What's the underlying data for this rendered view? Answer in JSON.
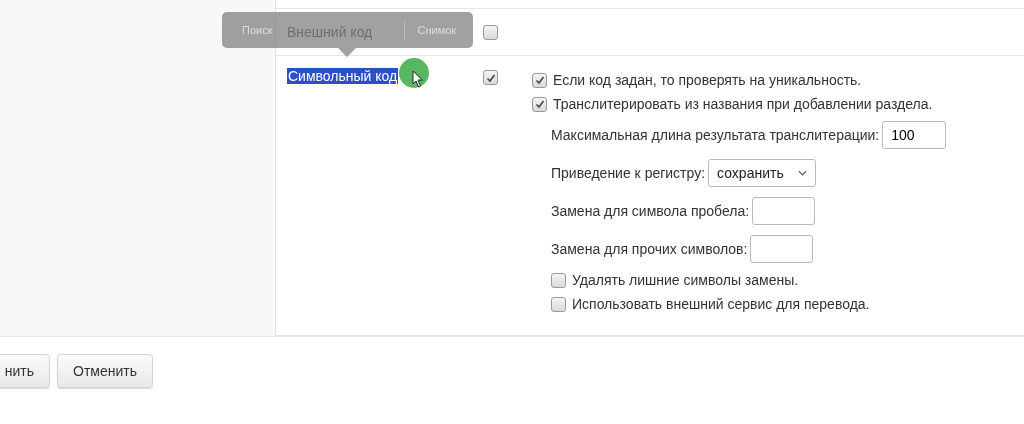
{
  "tooltip": {
    "items": [
      "Поиск",
      "Снимок"
    ]
  },
  "fields": [
    {
      "label": "Внешний код",
      "checked": false,
      "selected": false
    },
    {
      "label": "Символьный код",
      "checked": true,
      "selected": true
    }
  ],
  "options": [
    {
      "kind": "checkbox",
      "label": "Если код задан, то проверять на уникальность.",
      "checked": true
    },
    {
      "kind": "checkbox",
      "label": "Транслитерировать из названия при добавлении раздела.",
      "checked": true
    },
    {
      "kind": "input",
      "label": "Максимальная длина результата транслитерации:",
      "value": "100"
    },
    {
      "kind": "select",
      "label": "Приведение к регистру:",
      "value": "сохранить"
    },
    {
      "kind": "input",
      "label": "Замена для символа пробела:"
    },
    {
      "kind": "input",
      "label": "Замена для прочих символов:"
    },
    {
      "kind": "subcheckbox",
      "label": "Удалять лишние символы замены.",
      "checked": false
    },
    {
      "kind": "subcheckbox",
      "label": "Использовать внешний сервис для перевода.",
      "checked": false
    }
  ],
  "buttons": [
    "нить",
    "Отменить"
  ]
}
